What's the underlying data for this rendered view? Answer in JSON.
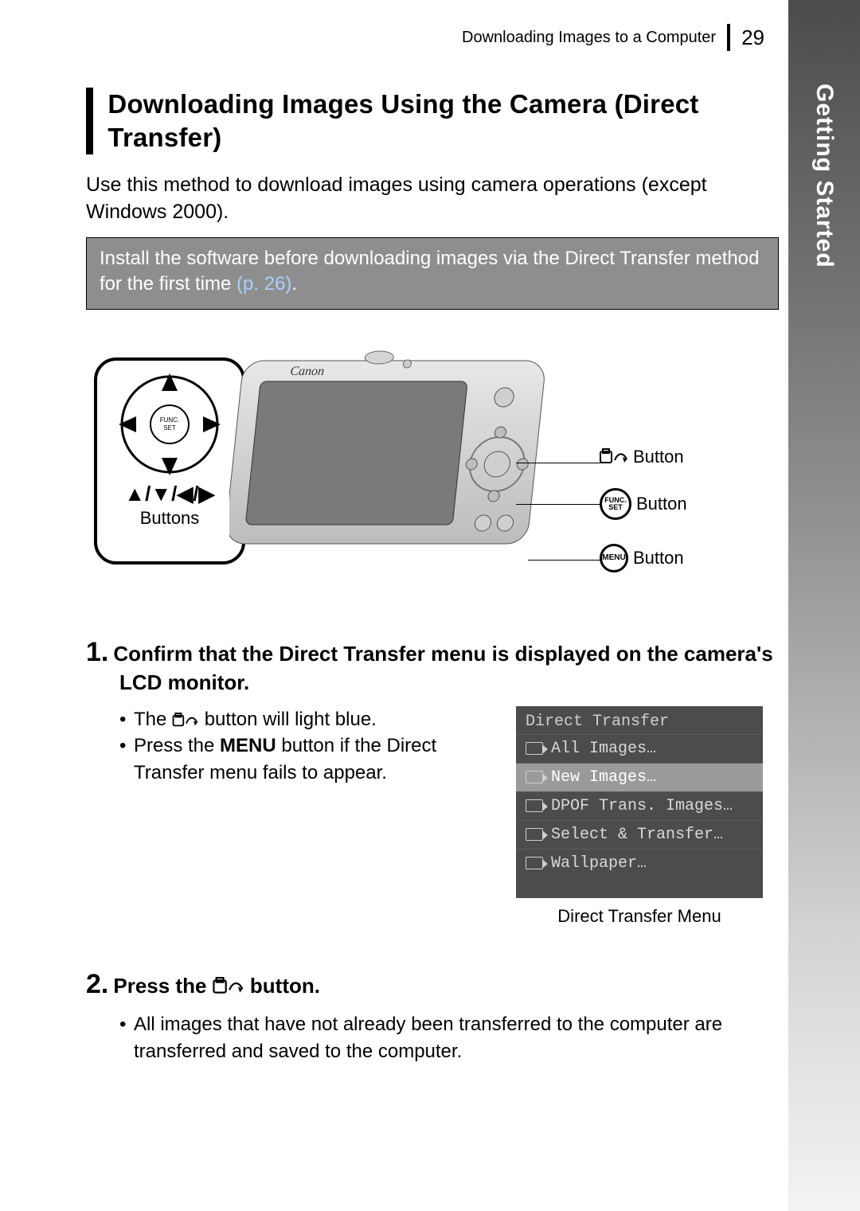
{
  "running_header": {
    "title": "Downloading Images to a Computer",
    "page": "29"
  },
  "side_tab": "Getting Started",
  "heading": "Downloading Images Using the Camera (Direct Transfer)",
  "intro": "Use this method to download images using camera operations (except Windows 2000).",
  "note": {
    "text": "Install the software before downloading images via the Direct Transfer method for the first time ",
    "link": "(p. 26)",
    "tail": "."
  },
  "diagram": {
    "brand": "Canon",
    "dpad_center": "FUNC. SET",
    "dpad_arrows": "▲/▼/◀/▶",
    "dpad_caption": "Buttons",
    "labels": {
      "print": "Button",
      "func": "Button",
      "menu": "Button",
      "func_ring": "FUNC. SET",
      "menu_ring": "MENU"
    }
  },
  "steps": [
    {
      "num": "1.",
      "head": "Confirm that the Direct Transfer menu is displayed on the camera's LCD monitor.",
      "bullets": [
        {
          "pre": "The ",
          "icon": true,
          "post": " button will light blue."
        },
        {
          "pre": "Press the ",
          "strong": "MENU",
          "post": " button if the Direct Transfer menu fails to appear."
        }
      ],
      "menu": {
        "title": "Direct Transfer",
        "items": [
          "All Images…",
          "New Images…",
          "DPOF Trans. Images…",
          "Select & Transfer…",
          "Wallpaper…"
        ],
        "selected_index": 1,
        "caption": "Direct Transfer Menu"
      }
    },
    {
      "num": "2.",
      "head_pre": "Press the ",
      "head_post": "  button.",
      "bullets": [
        {
          "text": "All images that have not already been transferred to the computer are transferred and saved to the computer."
        }
      ]
    }
  ]
}
